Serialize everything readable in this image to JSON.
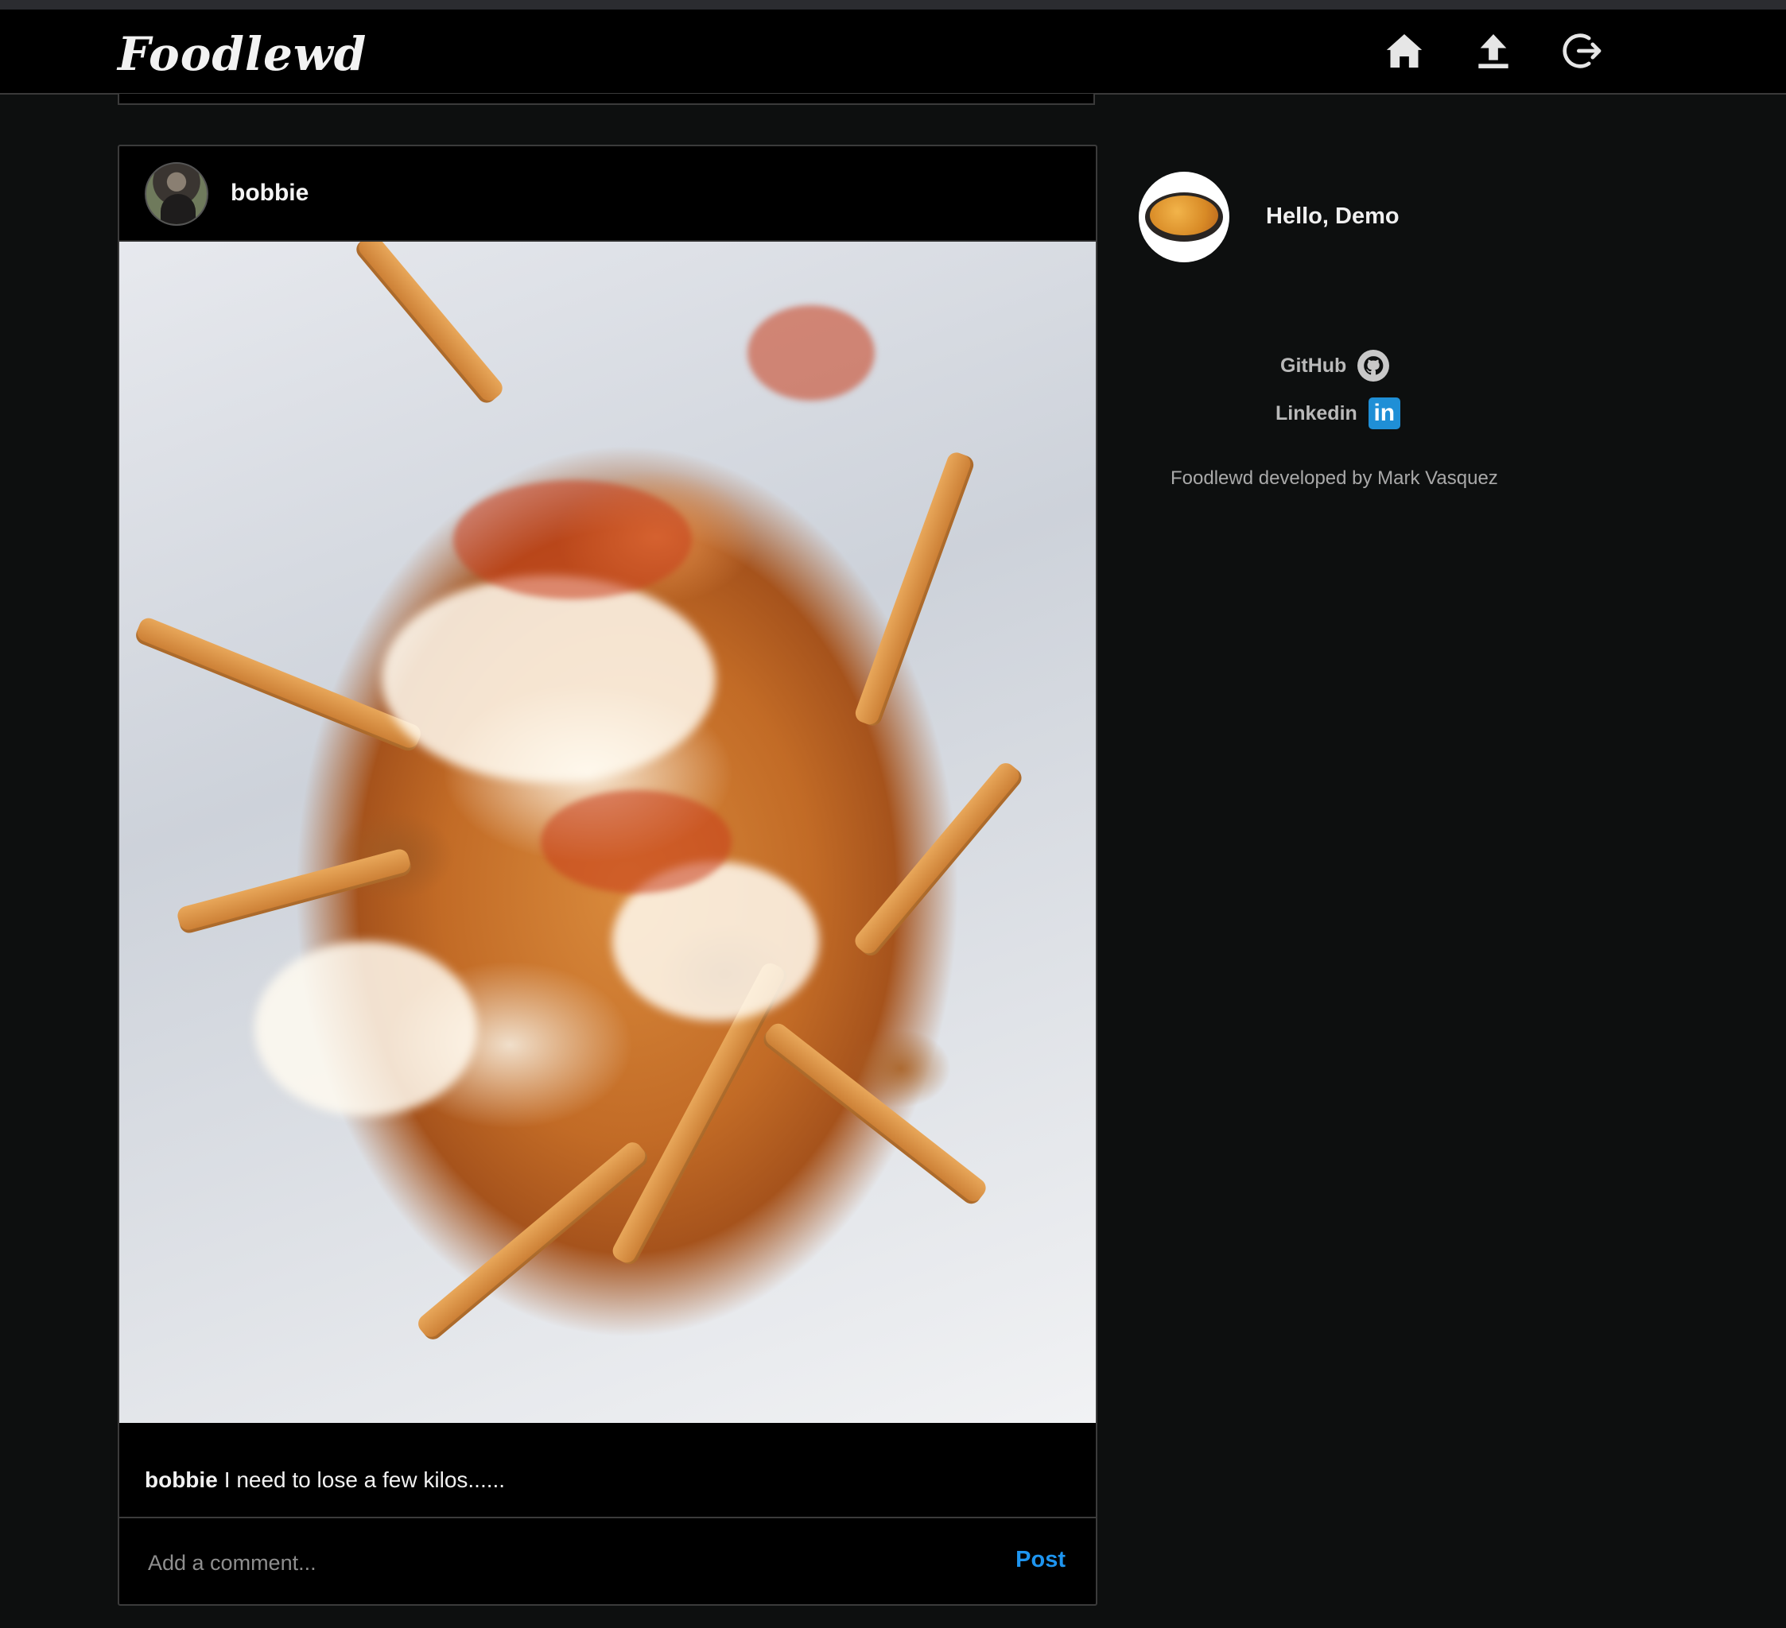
{
  "app": {
    "brand": "Foodlewd"
  },
  "nav": {
    "icons": [
      "home-icon",
      "upload-icon",
      "logout-icon"
    ]
  },
  "post": {
    "author": "bobbie",
    "image_alt": "Loaded fries",
    "caption_user": "bobbie",
    "caption_text": "I need to lose a few kilos......",
    "comment_placeholder": "Add a comment...",
    "post_label": "Post",
    "post_label_color": "#1e95f0"
  },
  "sidebar": {
    "greeting": "Hello, Demo",
    "links": [
      {
        "label": "GitHub",
        "icon": "github-icon"
      },
      {
        "label": "Linkedin",
        "icon": "linkedin-icon",
        "icon_text": "in"
      }
    ],
    "credit": "Foodlewd developed by Mark Vasquez"
  },
  "colors": {
    "background": "#0d0f0f",
    "card": "#000000",
    "border": "#3b3b3b",
    "accent": "#1e95f0"
  }
}
